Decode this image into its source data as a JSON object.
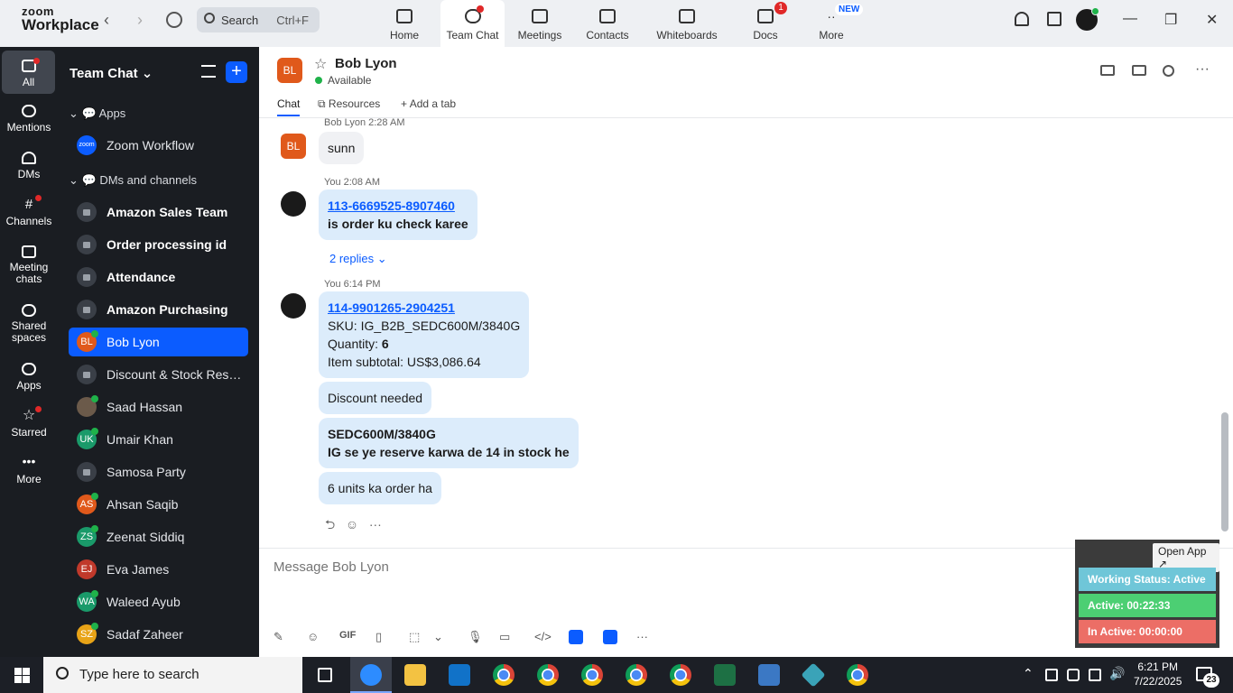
{
  "logo": {
    "line1": "zoom",
    "line2": "Workplace"
  },
  "search": {
    "label": "Search",
    "shortcut": "Ctrl+F"
  },
  "nav_tabs": [
    {
      "label": "Home"
    },
    {
      "label": "Team Chat"
    },
    {
      "label": "Meetings"
    },
    {
      "label": "Contacts"
    },
    {
      "label": "Whiteboards"
    },
    {
      "label": "Docs",
      "badge": "1"
    },
    {
      "label": "More",
      "badge": "NEW"
    }
  ],
  "rail": [
    {
      "label": "All"
    },
    {
      "label": "Mentions"
    },
    {
      "label": "DMs"
    },
    {
      "label": "Channels"
    },
    {
      "label": "Meeting chats"
    },
    {
      "label": "Shared spaces"
    },
    {
      "label": "Apps"
    },
    {
      "label": "Starred"
    },
    {
      "label": "More"
    }
  ],
  "sidebar": {
    "title": "Team Chat",
    "add": "+",
    "sections": {
      "apps": "Apps",
      "dms": "DMs and channels"
    },
    "items": [
      {
        "name": "Zoom Workflow",
        "kind": "app",
        "initials": "zoom",
        "color": "#0b5cff"
      },
      {
        "name": "Amazon Sales Team",
        "kind": "channel"
      },
      {
        "name": "Order processing id",
        "kind": "channel"
      },
      {
        "name": "Attendance",
        "kind": "channel"
      },
      {
        "name": "Amazon Purchasing",
        "kind": "channel"
      },
      {
        "name": "Bob Lyon",
        "kind": "dm",
        "initials": "BL",
        "color": "#e0591b"
      },
      {
        "name": "Discount & Stock Reser...",
        "kind": "channel"
      },
      {
        "name": "Saad Hassan",
        "kind": "dm",
        "initials": "",
        "color": "#6b5a4a"
      },
      {
        "name": "Umair Khan",
        "kind": "dm",
        "initials": "UK",
        "color": "#1a9a6a"
      },
      {
        "name": "Samosa Party",
        "kind": "channel"
      },
      {
        "name": "Ahsan Saqib",
        "kind": "dm",
        "initials": "AS",
        "color": "#e0591b"
      },
      {
        "name": "Zeenat Siddiq",
        "kind": "dm",
        "initials": "ZS",
        "color": "#1a9a6a"
      },
      {
        "name": "Eva James",
        "kind": "dm",
        "initials": "EJ",
        "color": "#c0392b"
      },
      {
        "name": "Waleed Ayub",
        "kind": "dm",
        "initials": "WA",
        "color": "#1a9a6a"
      },
      {
        "name": "Sadaf Zaheer",
        "kind": "dm",
        "initials": "SZ",
        "color": "#e8a317"
      }
    ]
  },
  "chat_header": {
    "initials": "BL",
    "name": "Bob Lyon",
    "status": "Available",
    "tabs": [
      "Chat",
      "Resources",
      "Add a tab"
    ]
  },
  "messages": {
    "m1": {
      "meta": "Bob Lyon 2:28 AM",
      "avatar": "BL",
      "text": "sunn"
    },
    "m2": {
      "meta": "You 2:08 AM",
      "link": "113-6669525-8907460",
      "text": "is order ku check karee",
      "replies": "2 replies"
    },
    "m3": {
      "meta": "You 6:14 PM",
      "link": "114-9901265-2904251",
      "sku": "SKU: IG_B2B_SEDC600M/3840G",
      "qty_label": "Quantity: ",
      "qty": "6",
      "subtotal": "Item subtotal: US$3,086.64"
    },
    "m4": {
      "text": "Discount needed"
    },
    "m5": {
      "line1": "SEDC600M/3840G",
      "line2": "IG se ye reserve karwa de 14 in stock he"
    },
    "m6": {
      "text": "6 units ka order ha"
    }
  },
  "composer": {
    "placeholder": "Message Bob Lyon"
  },
  "toolbar": {
    "gif": "GIF"
  },
  "widget": {
    "open_app": "Open App ↗",
    "working": "Working Status: Active",
    "active": "Active: 00:22:33",
    "inactive": "In Active: 00:00:00"
  },
  "taskbar": {
    "search_placeholder": "Type here to search",
    "time": "6:21 PM",
    "date": "7/22/2025",
    "notifications": "23"
  }
}
